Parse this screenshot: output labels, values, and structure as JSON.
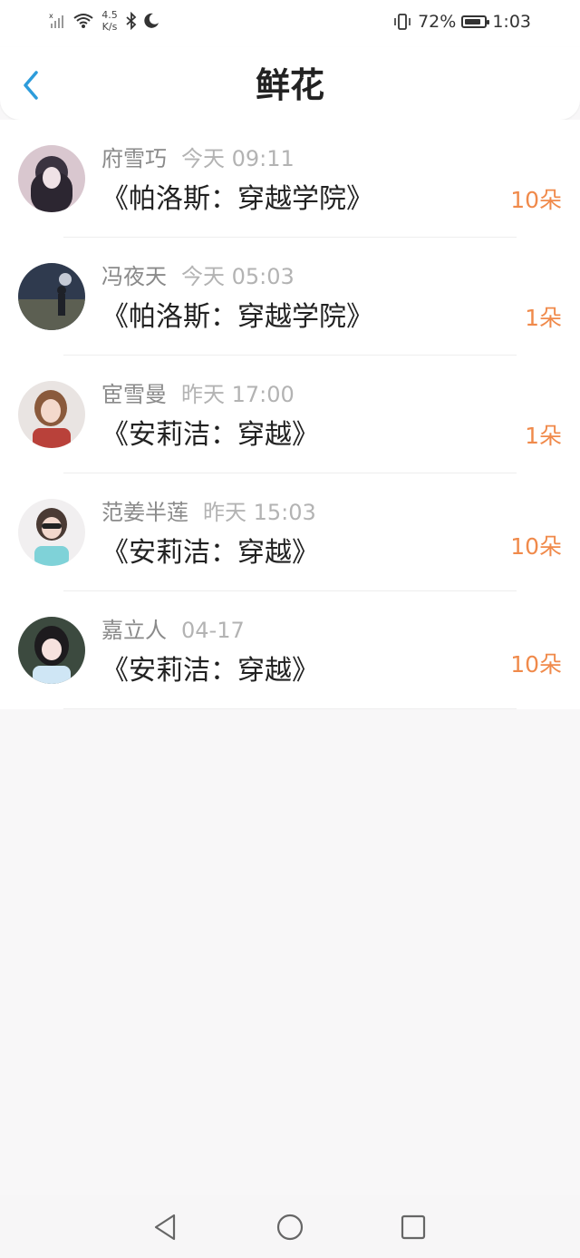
{
  "status_bar": {
    "network_speed_value": "4.5",
    "network_speed_unit": "K/s",
    "battery_percent": "72%",
    "battery_level": 0.72,
    "time": "1:03"
  },
  "header": {
    "title": "鲜花"
  },
  "colors": {
    "accent_back": "#2d9cdb",
    "count_orange": "#f08a4b"
  },
  "items": [
    {
      "name": "府雪巧",
      "time": "今天 09:11",
      "book": "《帕洛斯：穿越学院》",
      "count": "10朵"
    },
    {
      "name": "冯夜天",
      "time": "今天 05:03",
      "book": "《帕洛斯：穿越学院》",
      "count": "1朵"
    },
    {
      "name": "宦雪曼",
      "time": "昨天 17:00",
      "book": "《安莉洁：穿越》",
      "count": "1朵"
    },
    {
      "name": "范姜半莲",
      "time": "昨天 15:03",
      "book": "《安莉洁：穿越》",
      "count": "10朵"
    },
    {
      "name": "嘉立人",
      "time": "04-17",
      "book": "《安莉洁：穿越》",
      "count": "10朵"
    }
  ],
  "nav": {
    "icons": [
      "back-triangle-icon",
      "home-circle-icon",
      "recents-square-icon"
    ]
  }
}
